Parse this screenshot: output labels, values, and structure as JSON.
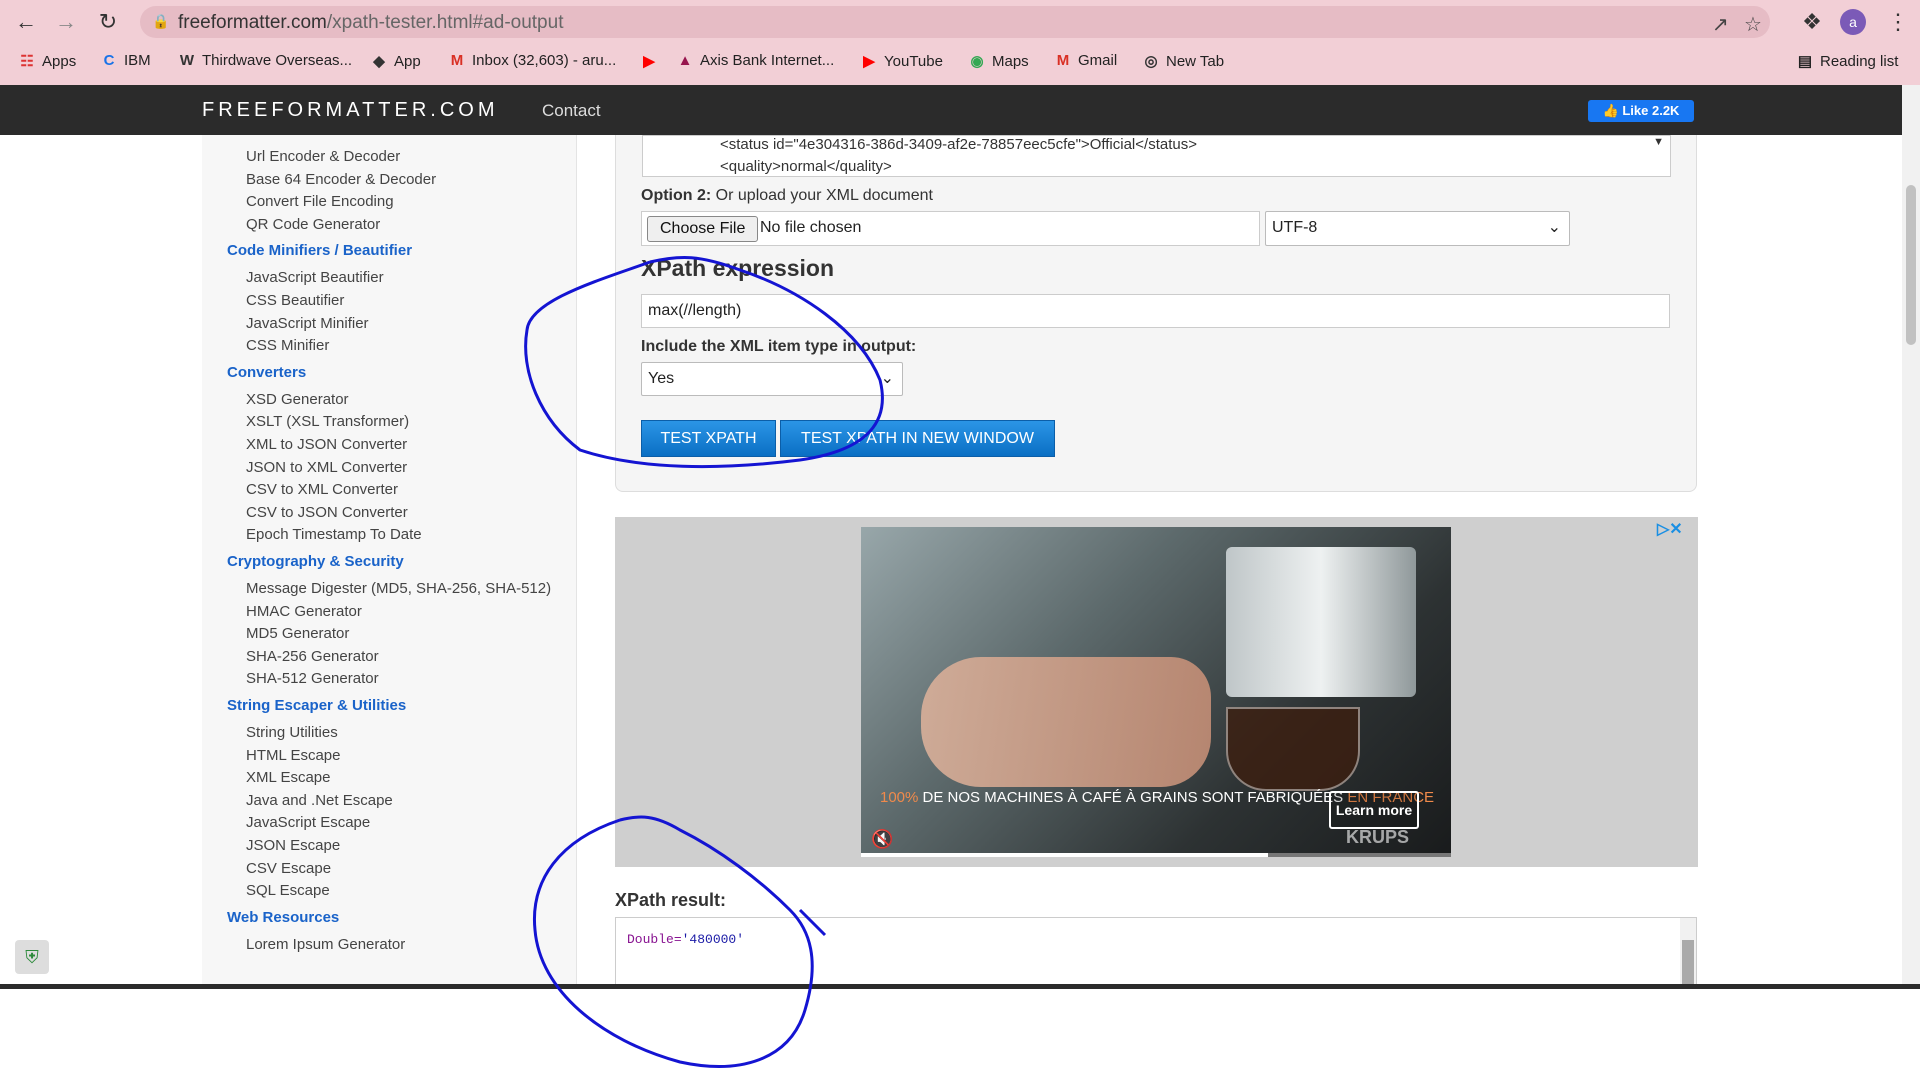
{
  "browser": {
    "url_domain": "freeformatter.com",
    "url_path": "/xpath-tester.html#ad-output",
    "bookmarks": [
      {
        "icon": "apps-grid-icon",
        "label": "Apps"
      },
      {
        "icon": "ibm-icon",
        "label": "IBM"
      },
      {
        "icon": "wordpress-icon",
        "label": "Thirdwave Overseas..."
      },
      {
        "icon": "app-icon",
        "label": "App"
      },
      {
        "icon": "gmail-icon",
        "label": "Inbox (32,603) - aru..."
      },
      {
        "icon": "youtube-icon",
        "label": ""
      },
      {
        "icon": "axis-bank-icon",
        "label": "Axis Bank Internet..."
      },
      {
        "icon": "youtube-icon",
        "label": "YouTube"
      },
      {
        "icon": "maps-icon",
        "label": "Maps"
      },
      {
        "icon": "gmail-icon",
        "label": "Gmail"
      },
      {
        "icon": "globe-icon",
        "label": "New Tab"
      }
    ],
    "reading_list": "Reading list",
    "avatar_letter": "a"
  },
  "site": {
    "logo": "FREEFORMATTER.COM",
    "contact": "Contact",
    "fb_like": "Like 2.2K"
  },
  "sidebar": {
    "items": [
      {
        "type": "link",
        "label": "Url Encoder & Decoder"
      },
      {
        "type": "link",
        "label": "Base 64 Encoder & Decoder"
      },
      {
        "type": "link",
        "label": "Convert File Encoding"
      },
      {
        "type": "link",
        "label": "QR Code Generator"
      },
      {
        "type": "cat",
        "label": "Code Minifiers / Beautifier"
      },
      {
        "type": "link",
        "label": "JavaScript Beautifier"
      },
      {
        "type": "link",
        "label": "CSS Beautifier"
      },
      {
        "type": "link",
        "label": "JavaScript Minifier"
      },
      {
        "type": "link",
        "label": "CSS Minifier"
      },
      {
        "type": "cat",
        "label": "Converters"
      },
      {
        "type": "link",
        "label": "XSD Generator"
      },
      {
        "type": "link",
        "label": "XSLT (XSL Transformer)"
      },
      {
        "type": "link",
        "label": "XML to JSON Converter"
      },
      {
        "type": "link",
        "label": "JSON to XML Converter"
      },
      {
        "type": "link",
        "label": "CSV to XML Converter"
      },
      {
        "type": "link",
        "label": "CSV to JSON Converter"
      },
      {
        "type": "link",
        "label": "Epoch Timestamp To Date"
      },
      {
        "type": "cat",
        "label": "Cryptography & Security"
      },
      {
        "type": "link",
        "label": "Message Digester (MD5, SHA-256, SHA-512)"
      },
      {
        "type": "link",
        "label": "HMAC Generator"
      },
      {
        "type": "link",
        "label": "MD5 Generator"
      },
      {
        "type": "link",
        "label": "SHA-256 Generator"
      },
      {
        "type": "link",
        "label": "SHA-512 Generator"
      },
      {
        "type": "cat",
        "label": "String Escaper & Utilities"
      },
      {
        "type": "link",
        "label": "String Utilities"
      },
      {
        "type": "link",
        "label": "HTML Escape"
      },
      {
        "type": "link",
        "label": "XML Escape"
      },
      {
        "type": "link",
        "label": "Java and .Net Escape"
      },
      {
        "type": "link",
        "label": "JavaScript Escape"
      },
      {
        "type": "link",
        "label": "JSON Escape"
      },
      {
        "type": "link",
        "label": "CSV Escape"
      },
      {
        "type": "link",
        "label": "SQL Escape"
      },
      {
        "type": "cat",
        "label": "Web Resources"
      },
      {
        "type": "link",
        "label": "Lorem Ipsum Generator"
      }
    ]
  },
  "form": {
    "xml_line1": "<status id=\"4e304316-386d-3409-af2e-78857eec5cfe\">Official</status>",
    "xml_line2": "<quality>normal</quality>",
    "option2_bold": "Option 2:",
    "option2_text": "Or upload your XML document",
    "choose_file": "Choose File",
    "no_file": "No file chosen",
    "encoding": "UTF-8",
    "xpath_heading": "XPath expression",
    "xpath_value": "max(//length)",
    "include_label": "Include the XML item type in output:",
    "include_value": "Yes",
    "test_button": "TEST XPATH",
    "test_new_window_button": "TEST XPATH IN NEW WINDOW"
  },
  "ad": {
    "pct": "100%",
    "text": " DE NOS MACHINES À CAFÉ À GRAINS SONT FABRIQUÉES ",
    "fr": "EN FRANCE",
    "learn_more": "Learn more",
    "brand": "KRUPS",
    "progress": 0.69
  },
  "result": {
    "label": "XPath result:",
    "type": "Double",
    "eq": "=",
    "value": "'480000'"
  }
}
